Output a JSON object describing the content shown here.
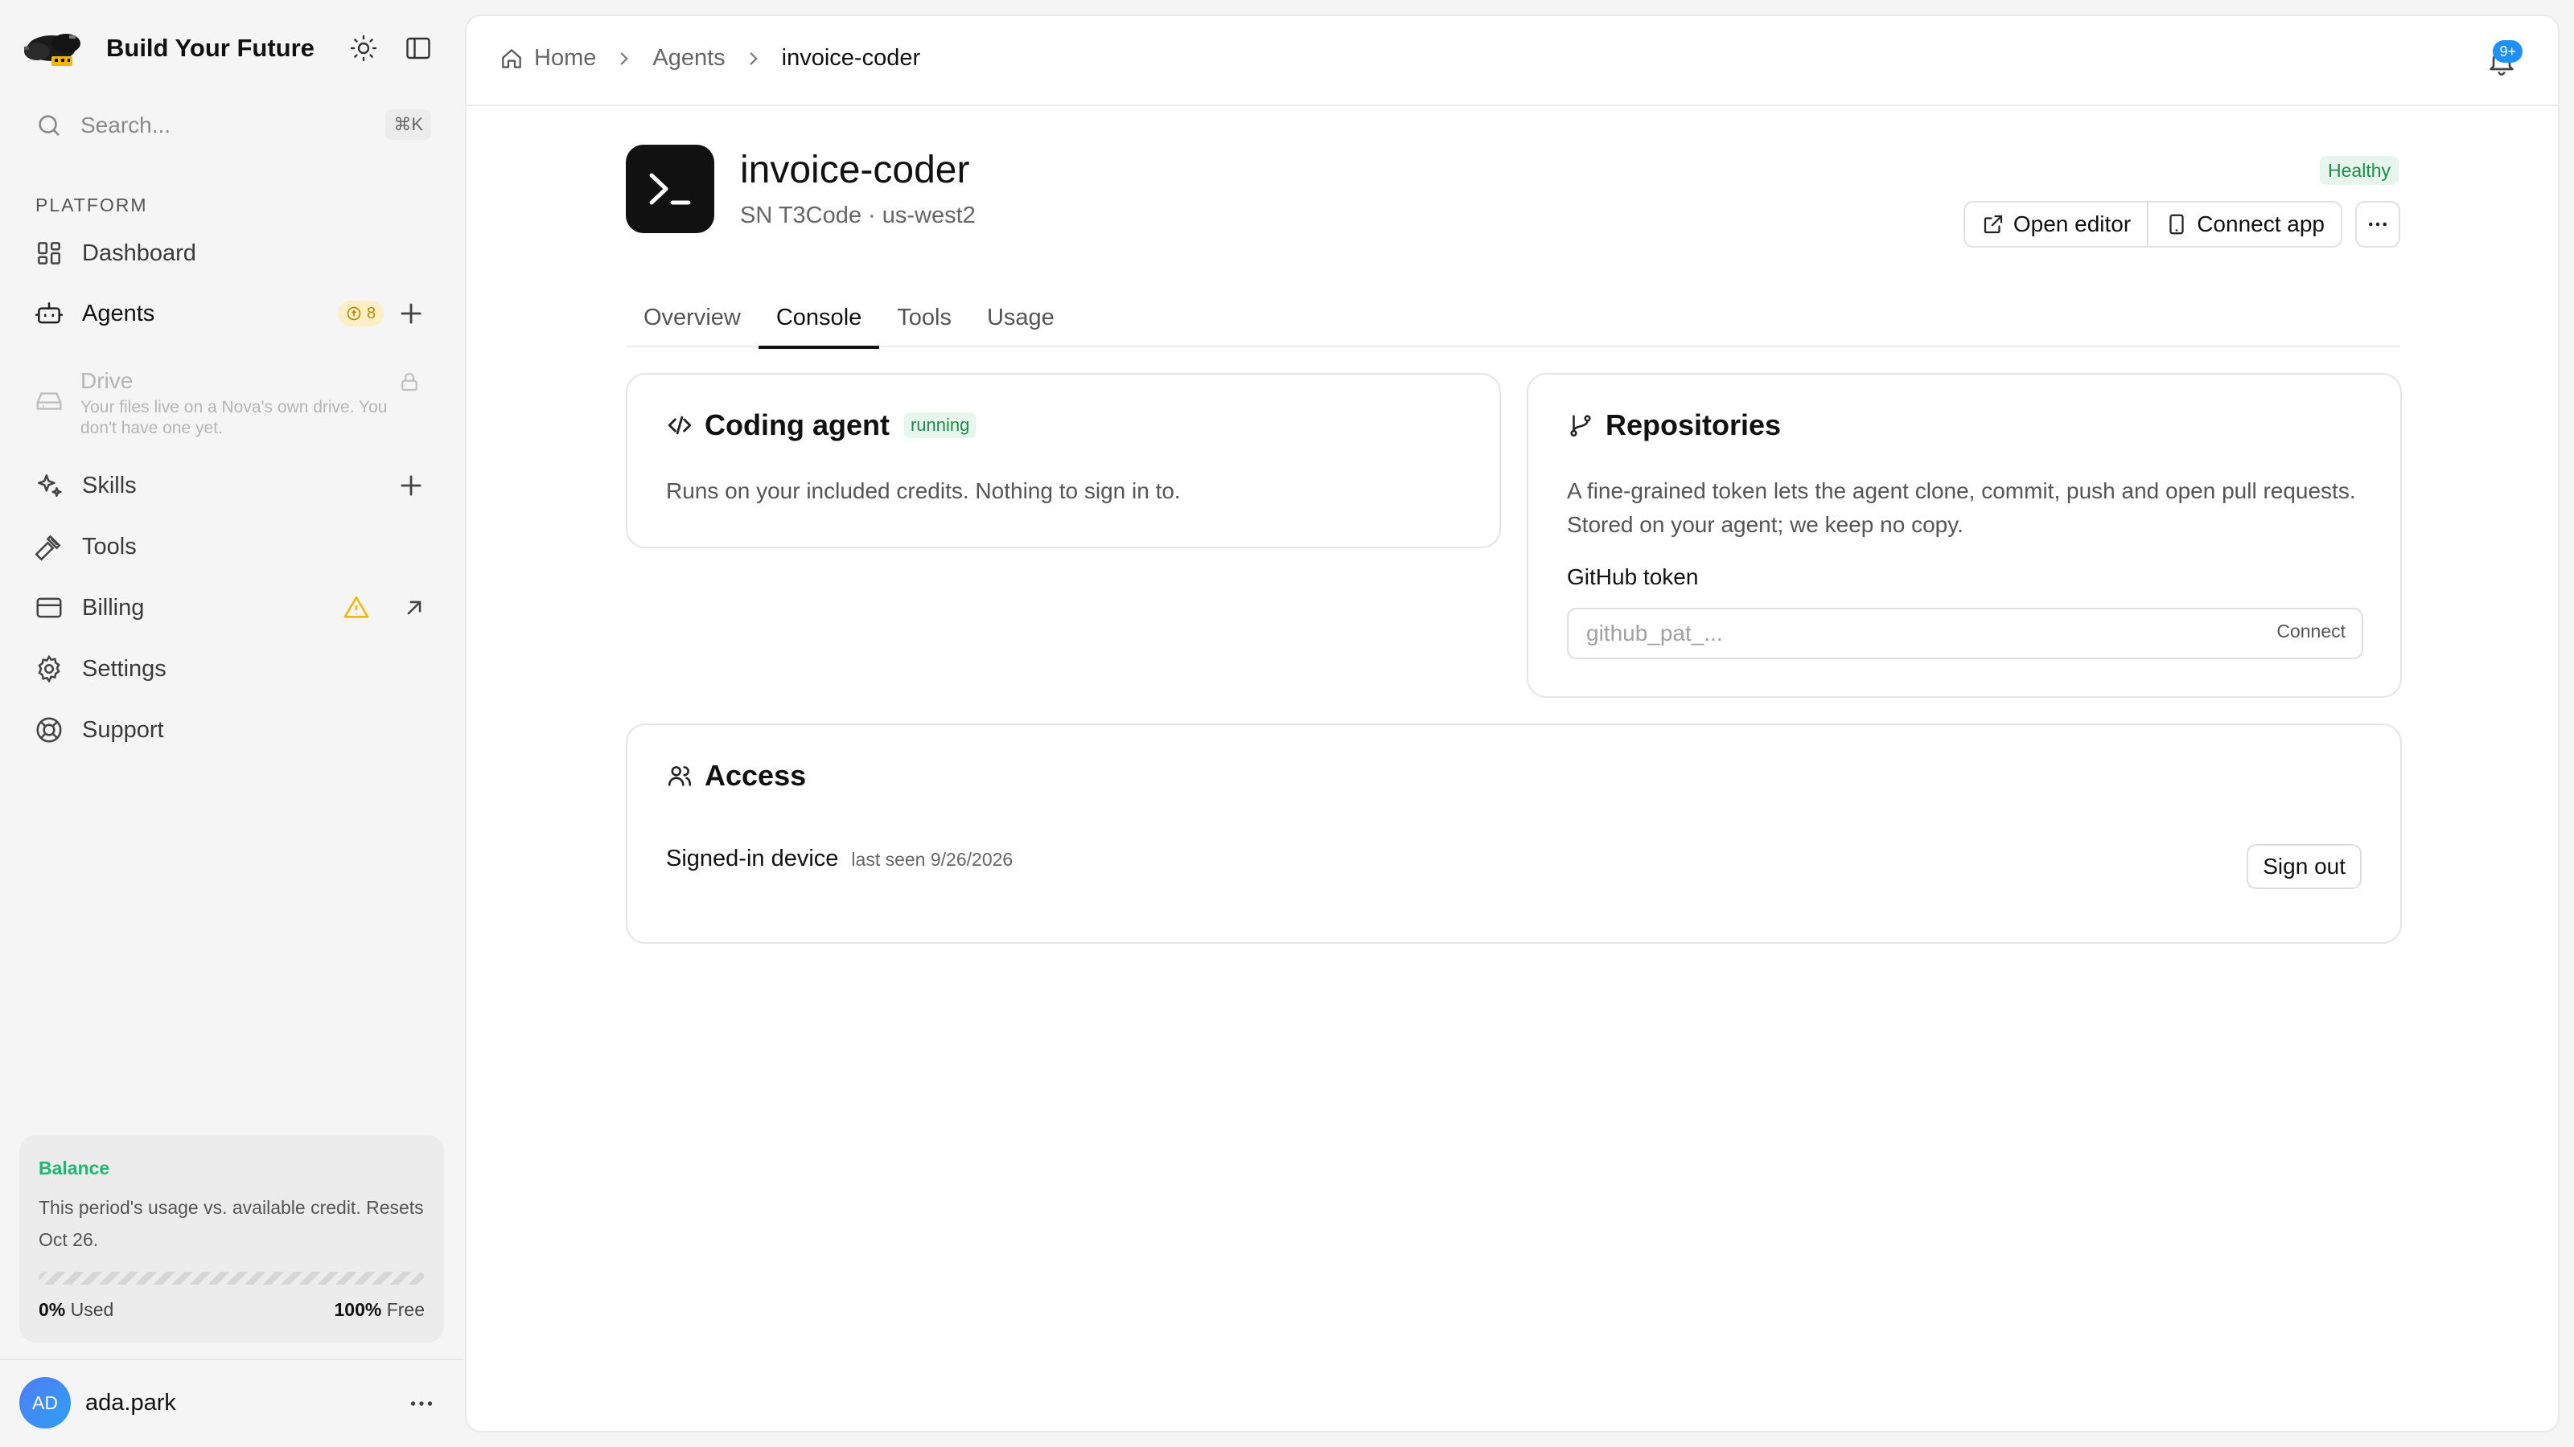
{
  "sidebar": {
    "brand": "Build Your Future",
    "search": {
      "placeholder": "Search...",
      "shortcut": "⌘K"
    },
    "section_label": "PLATFORM",
    "items": {
      "dashboard": "Dashboard",
      "agents": "Agents",
      "agents_badge": "8",
      "drive": "Drive",
      "drive_desc": "Your files live on a Nova's own drive. You don't have one yet.",
      "skills": "Skills",
      "tools": "Tools",
      "billing": "Billing",
      "settings": "Settings",
      "support": "Support"
    },
    "balance": {
      "title": "Balance",
      "description": "This period's usage vs. available credit. Resets Oct 26.",
      "used_pct": "0%",
      "used_label": "Used",
      "free_pct": "100%",
      "free_label": "Free",
      "used_fraction": 0
    },
    "user": {
      "initials": "AD",
      "name": "ada.park"
    }
  },
  "topbar": {
    "breadcrumb": [
      "Home",
      "Agents",
      "invoice-coder"
    ],
    "notifications_badge": "9+"
  },
  "agent": {
    "name": "invoice-coder",
    "subtitle": "SN T3Code · us-west2",
    "health": "Healthy",
    "actions": {
      "open_editor": "Open editor",
      "connect_app": "Connect app"
    }
  },
  "tabs": [
    "Overview",
    "Console",
    "Tools",
    "Usage"
  ],
  "active_tab": "Console",
  "coding": {
    "title": "Coding agent",
    "status": "running",
    "description": "Runs on your included credits. Nothing to sign in to."
  },
  "repositories": {
    "title": "Repositories",
    "description": "A fine-grained token lets the agent clone, commit, push and open pull requests. Stored on your agent; we keep no copy.",
    "token_label": "GitHub token",
    "token_placeholder": "github_pat_...",
    "token_value": "",
    "connect_label": "Connect"
  },
  "access": {
    "title": "Access",
    "device_label": "Signed-in device",
    "last_seen": "last seen 9/26/2026",
    "sign_out": "Sign out"
  },
  "colors": {
    "accent_green": "#22b573",
    "health_green": "#1f8a4c",
    "warning": "#f2b705",
    "notif_blue": "#1e90ff",
    "avatar_blue": "#3b82f6"
  },
  "icons": {
    "brand": "cloud-logo",
    "theme": "sun-icon",
    "layout": "sidebar-panel-icon",
    "search": "search-icon",
    "dashboard": "grid-icon",
    "agents": "robot-icon",
    "drive": "hard-drive-icon",
    "lock": "lock-icon",
    "skills": "sparkles-icon",
    "tools": "hammer-icon",
    "billing": "credit-card-icon",
    "warning": "warning-icon",
    "external": "arrow-up-right-icon",
    "settings": "gear-icon",
    "support": "lifebuoy-icon",
    "notifications": "bell-icon",
    "terminal": "terminal-icon",
    "code": "code-icon",
    "branch": "git-branch-icon",
    "users": "users-icon"
  }
}
